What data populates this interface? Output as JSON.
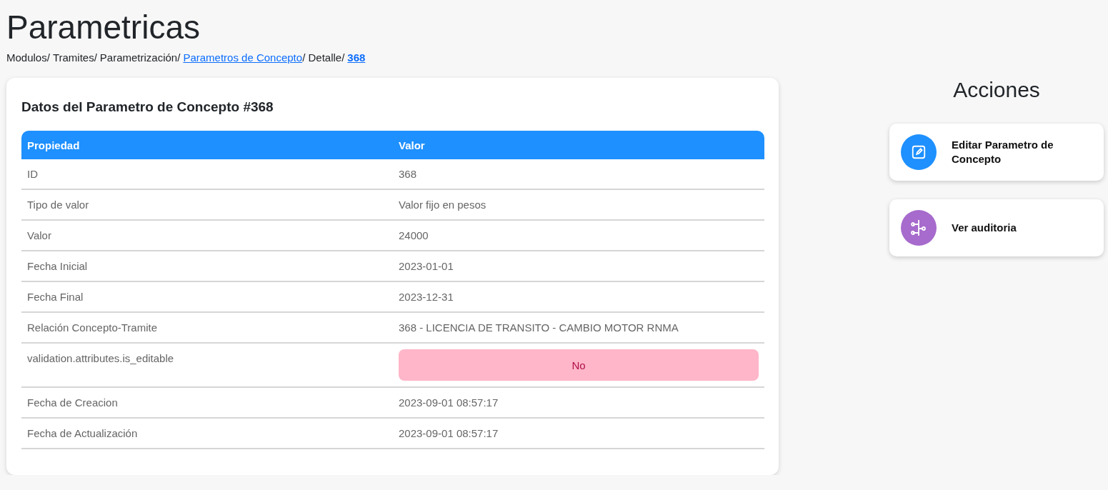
{
  "page": {
    "title": "Parametricas"
  },
  "breadcrumb": [
    {
      "label": "Modulos/",
      "kind": "plain"
    },
    {
      "label": "Tramites/",
      "kind": "plain"
    },
    {
      "label": "Parametrización/",
      "kind": "plain"
    },
    {
      "label": "Parametros de Concepto",
      "kind": "link"
    },
    {
      "label": "/ Detalle/",
      "kind": "plain"
    },
    {
      "label": "368",
      "kind": "current"
    }
  ],
  "card": {
    "title": "Datos del Parametro de Concepto #368",
    "table": {
      "columns": [
        "Propiedad",
        "Valor"
      ],
      "rows": [
        {
          "property": "ID",
          "value": "368",
          "kind": "text"
        },
        {
          "property": "Tipo de valor",
          "value": "Valor fijo en pesos",
          "kind": "text"
        },
        {
          "property": "Valor",
          "value": "24000",
          "kind": "text"
        },
        {
          "property": "Fecha Inicial",
          "value": "2023-01-01",
          "kind": "text"
        },
        {
          "property": "Fecha Final",
          "value": "2023-12-31",
          "kind": "text"
        },
        {
          "property": "Relación Concepto-Tramite",
          "value": "368 - LICENCIA DE TRANSITO - CAMBIO MOTOR RNMA",
          "kind": "text"
        },
        {
          "property": "validation.attributes.is_editable",
          "value": "No",
          "kind": "badge"
        },
        {
          "property": "Fecha de Creacion",
          "value": "2023-09-01 08:57:17",
          "kind": "text"
        },
        {
          "property": "Fecha de Actualización",
          "value": "2023-09-01 08:57:17",
          "kind": "text"
        }
      ]
    }
  },
  "actions": {
    "title": "Acciones",
    "items": [
      {
        "label": "Editar Parametro de Concepto",
        "kind": "edit",
        "color": "#1e90ff"
      },
      {
        "label": "Ver auditoria",
        "kind": "audit",
        "color": "#a66bcc"
      }
    ]
  }
}
